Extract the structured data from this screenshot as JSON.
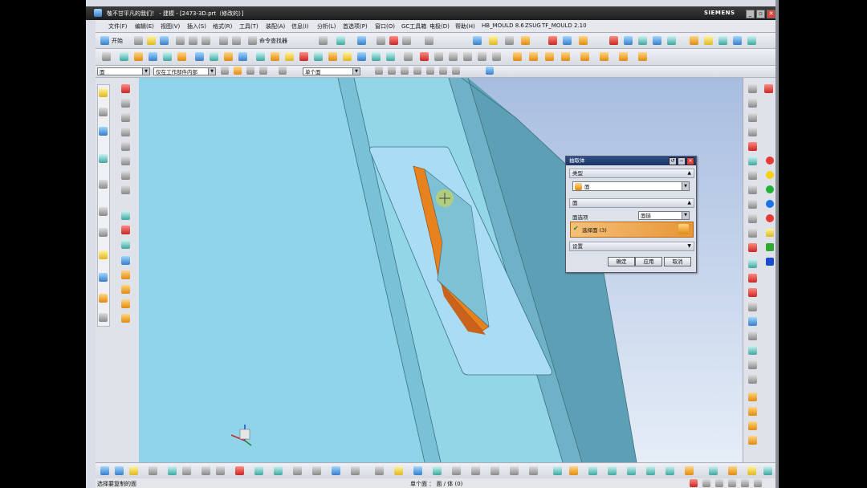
{
  "window": {
    "title": "敬不甘平凡的我们！ - 建模 - [2473-3D.prt（修改的）]",
    "brand": "SIEMENS",
    "minimize_icon": "minimize-icon",
    "restore_icon": "restore-icon",
    "close_icon": "close-icon"
  },
  "menu": [
    "文件(F)",
    "编辑(E)",
    "视图(V)",
    "插入(S)",
    "格式(R)",
    "工具(T)",
    "装配(A)",
    "信息(I)",
    "分析(L)",
    "首选项(P)",
    "窗口(O)",
    "GC工具箱",
    "电极(D)",
    "帮助(H)",
    "HB_MOULD 8.6",
    "ZSUG",
    "TF_MOULD 2.10"
  ],
  "toolbar1": {
    "start_label": "开始",
    "command_finder_label": "命令查找器"
  },
  "selection_bar": {
    "filter_value": "面",
    "scope_value": "仅在工作部件内部",
    "face_rule_value": "单个面"
  },
  "dialog": {
    "title": "抽取体",
    "type_section": "类型",
    "type_value": "面",
    "face_section": "面",
    "face_option_label": "面选项",
    "face_option_value": "面链",
    "select_face_label": "选择面 (3)",
    "settings_section": "设置",
    "ok_label": "确定",
    "apply_label": "应用",
    "cancel_label": "取消"
  },
  "status": {
    "prompt": "选择要复制的面",
    "info": "单个面 ： 面 / 体 (0)"
  },
  "colors": {
    "model_surface": "#8ed3e6",
    "selected_face": "#e8821e",
    "titlebar": "#2a2a2a",
    "dialog_title": "#1e3b6e"
  }
}
